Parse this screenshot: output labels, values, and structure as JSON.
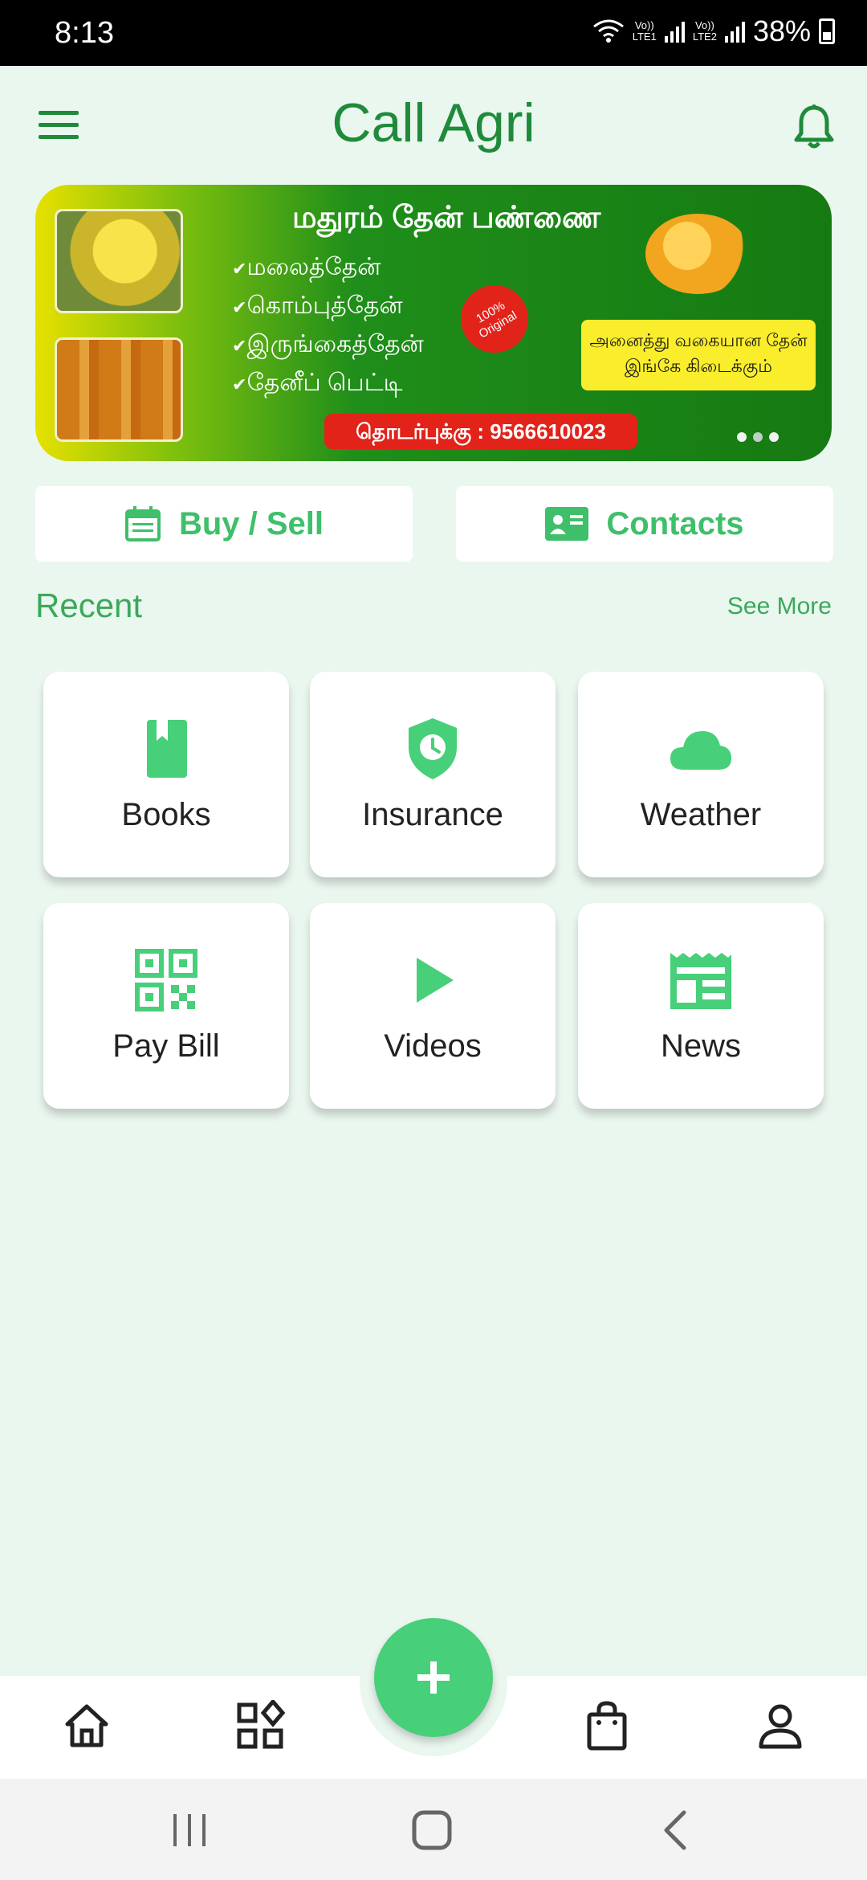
{
  "status_bar": {
    "time": "8:13",
    "sim1_label": "Vo))\nLTE1",
    "sim2_label": "Vo))\nLTE2",
    "battery": "38%"
  },
  "header": {
    "title": "Call Agri",
    "menu_icon": "hamburger-menu-icon",
    "notification_icon": "bell-icon"
  },
  "banner": {
    "heading": "மதுரம் தேன் பண்ணை",
    "items": [
      "மலைத்தேன்",
      "கொம்புத்தேன்",
      "இருங்கைத்தேன்",
      "தேனீப் பெட்டி"
    ],
    "badge": "100% Original",
    "side_text": "அனைத்து வகையான தேன் இங்கே கிடைக்கும்",
    "contact": "தொடர்புக்கு : 9566610023",
    "pager_dots": 3,
    "active_dot": 1
  },
  "actions": {
    "buy_sell_label": "Buy / Sell",
    "contacts_label": "Contacts"
  },
  "recent": {
    "title": "Recent",
    "see_more": "See More",
    "tiles": [
      {
        "label": "Books",
        "icon": "book-icon"
      },
      {
        "label": "Insurance",
        "icon": "shield-clock-icon"
      },
      {
        "label": "Weather",
        "icon": "cloud-icon"
      },
      {
        "label": "Pay Bill",
        "icon": "qr-code-icon"
      },
      {
        "label": "Videos",
        "icon": "play-icon"
      },
      {
        "label": "News",
        "icon": "newspaper-icon"
      }
    ]
  },
  "bottom_nav": {
    "items": [
      "home-icon",
      "categories-icon",
      "add-fab-icon",
      "shopping-bag-icon",
      "profile-icon"
    ]
  },
  "colors": {
    "accent": "#3fbf6a",
    "title_green": "#1f8b3a",
    "background": "#eaf7ef",
    "fab": "#47cf7a"
  }
}
